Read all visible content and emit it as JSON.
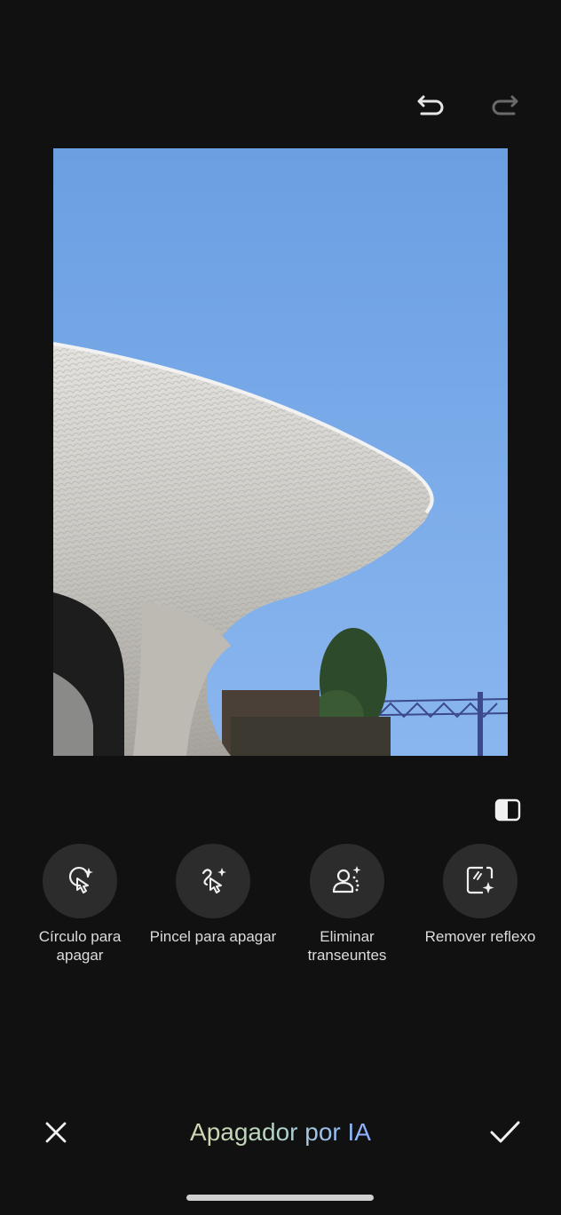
{
  "toolbar": {
    "undo_icon": "undo-icon",
    "redo_icon": "redo-icon"
  },
  "photo": {
    "description_icon": "edited-photo"
  },
  "compare_icon": "compare-icon",
  "tools": [
    {
      "label": "Círculo para apagar",
      "icon": "circle-to-erase-icon"
    },
    {
      "label": "Pincel para apagar",
      "icon": "brush-to-erase-icon"
    },
    {
      "label": "Eliminar transeuntes",
      "icon": "remove-passersby-icon"
    },
    {
      "label": "Remover reflexo",
      "icon": "remove-reflection-icon"
    }
  ],
  "bottom": {
    "title": "Apagador por IA",
    "close_icon": "close-icon",
    "confirm_icon": "check-icon"
  },
  "colors": {
    "background": "#111111",
    "tool_circle": "#2c2c2c",
    "title_gradient_start": "#e8d6a3",
    "title_gradient_end": "#8f8cff"
  }
}
